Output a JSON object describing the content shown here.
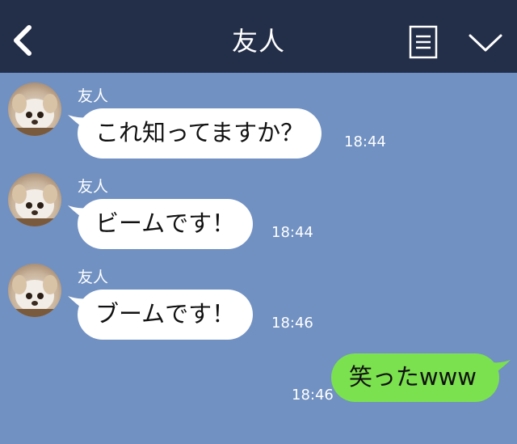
{
  "header": {
    "title": "友人",
    "back_icon": "chevron-left-icon",
    "menu_icon": "document-list-icon",
    "collapse_icon": "chevron-down-icon",
    "background": "#232e48"
  },
  "chat": {
    "background": "#7191c2",
    "incoming_bubble_color": "#ffffff",
    "outgoing_bubble_color": "#7be14e",
    "messages": [
      {
        "sender": "友人",
        "text": "これ知ってますか？",
        "time": "18:44"
      },
      {
        "sender": "友人",
        "text": "ビームです！",
        "time": "18:44"
      },
      {
        "sender": "友人",
        "text": "ブームです！",
        "time": "18:46"
      }
    ],
    "outgoing": {
      "text": "笑ったwww",
      "time": "18:46"
    }
  }
}
